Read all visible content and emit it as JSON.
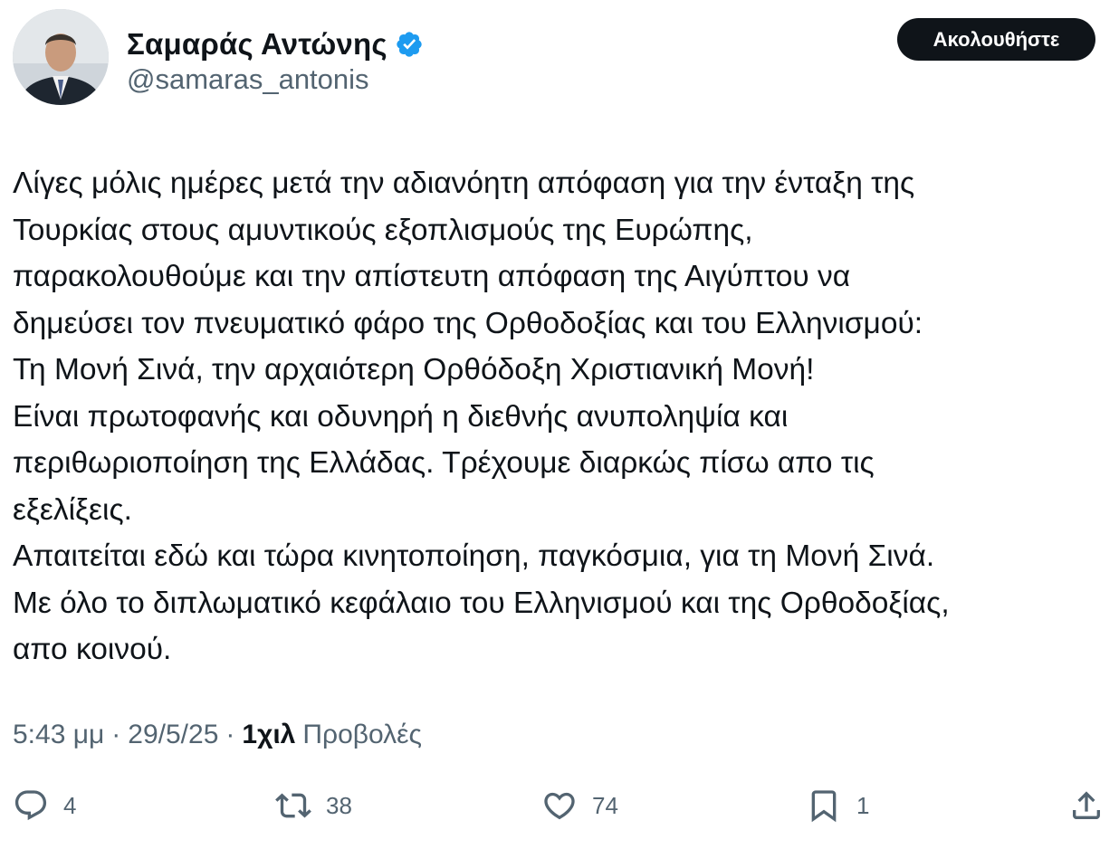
{
  "author": {
    "display_name": "Σαμαράς Αντώνης",
    "handle": "@samaras_antonis",
    "verified": true,
    "verified_color": "#1d9bf0"
  },
  "follow_button": {
    "label": "Ακολουθήστε"
  },
  "tweet": {
    "lines": [
      "Λίγες μόλις ημέρες μετά την αδιανόητη απόφαση για την ένταξη της",
      "Τουρκίας στους αμυντικούς εξοπλισμούς της Ευρώπης,",
      "παρακολουθούμε  και την  απίστευτη απόφαση της Αιγύπτου να",
      "δημεύσει  τον πνευματικό φάρο της Ορθοδοξίας και του Ελληνισμού:",
      "Τη Μονή Σινά, την αρχαιότερη Ορθόδοξη Χριστιανική Μονή!",
      "Είναι πρωτοφανής και οδυνηρή η διεθνής ανυποληψία και",
      "περιθωριοποίηση της Ελλάδας. Τρέχουμε διαρκώς πίσω απο τις",
      "εξελίξεις.",
      "Απαιτείται εδώ και τώρα κινητοποίηση, παγκόσμια, για τη Μονή Σινά.",
      "Με όλο το διπλωματικό κεφάλαιο του Ελληνισμού και της Ορθοδοξίας,",
      "απο κοινού."
    ]
  },
  "meta": {
    "time": "5:43 μμ",
    "separator": "·",
    "date": "29/5/25",
    "views_count": "1χιλ",
    "views_label": "Προβολές"
  },
  "actions": {
    "replies": {
      "icon": "reply-icon",
      "count": "4"
    },
    "reposts": {
      "icon": "repost-icon",
      "count": "38"
    },
    "likes": {
      "icon": "heart-icon",
      "count": "74"
    },
    "bookmarks": {
      "icon": "bookmark-icon",
      "count": "1"
    },
    "share": {
      "icon": "share-icon"
    }
  },
  "colors": {
    "text": "#0f1419",
    "secondary": "#536471",
    "button_bg": "#0f1419"
  }
}
